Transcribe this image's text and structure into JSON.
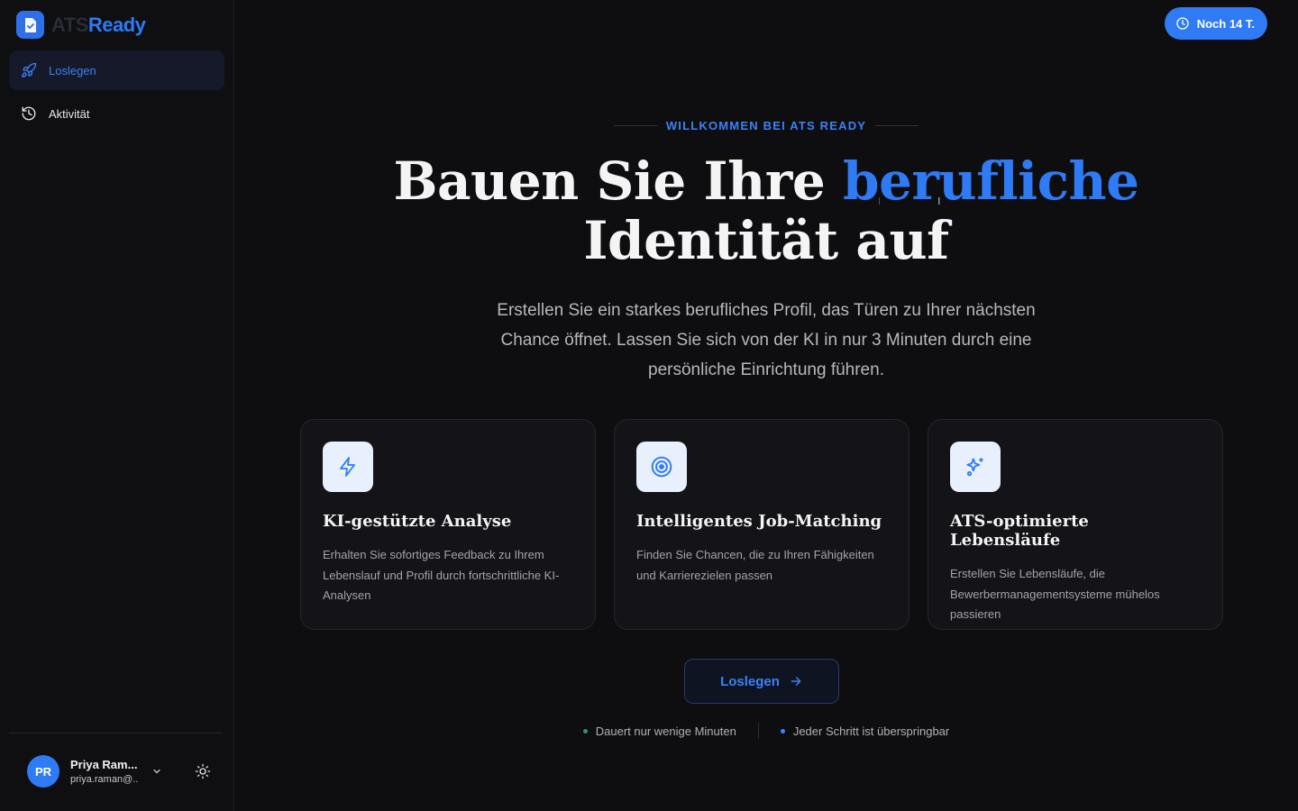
{
  "brand": {
    "part1": "ATS",
    "part2": "Ready",
    "logo_icon": "doc-check-icon"
  },
  "sidebar": {
    "items": [
      {
        "label": "Loslegen",
        "icon": "rocket-icon",
        "active": true
      },
      {
        "label": "Aktivität",
        "icon": "history-icon",
        "active": false
      }
    ]
  },
  "user": {
    "initials": "PR",
    "name": "Priya Ram...",
    "email": "priya.raman@..."
  },
  "trial": {
    "label": "Noch 14 T.",
    "icon": "clock-icon"
  },
  "hero": {
    "eyebrow": "WILLKOMMEN BEI ATS READY",
    "title_prefix": "Bauen Sie Ihre ",
    "title_accent": "berufliche",
    "title_line2": "Identität auf",
    "subtitle": "Erstellen Sie ein starkes berufliches Profil, das Türen zu Ihrer nächsten Chance öffnet. Lassen Sie sich von der KI in nur 3 Minuten durch eine persönliche Einrichtung führen."
  },
  "cards": [
    {
      "icon": "lightning-icon",
      "title": "KI-gestützte Analyse",
      "desc": "Erhalten Sie sofortiges Feedback zu Ihrem Lebenslauf und Profil durch fortschrittliche KI-Analysen"
    },
    {
      "icon": "target-icon",
      "title": "Intelligentes Job-Matching",
      "desc": "Finden Sie Chancen, die zu Ihren Fähigkeiten und Karrierezielen passen"
    },
    {
      "icon": "sparkles-icon",
      "title": "ATS-optimierte Lebensläufe",
      "desc": "Erstellen Sie Lebensläufe, die Bewerbermanagementsysteme mühelos passieren"
    }
  ],
  "cta": {
    "label": "Loslegen"
  },
  "notes": [
    {
      "text": "Dauert nur wenige Minuten",
      "dot_color": "#3a8f6b"
    },
    {
      "text": "Jeder Schritt ist überspringbar",
      "dot_color": "#3b82f6"
    }
  ],
  "colors": {
    "accent": "#2f7af5",
    "background": "#0e0e11",
    "card": "#131318"
  }
}
